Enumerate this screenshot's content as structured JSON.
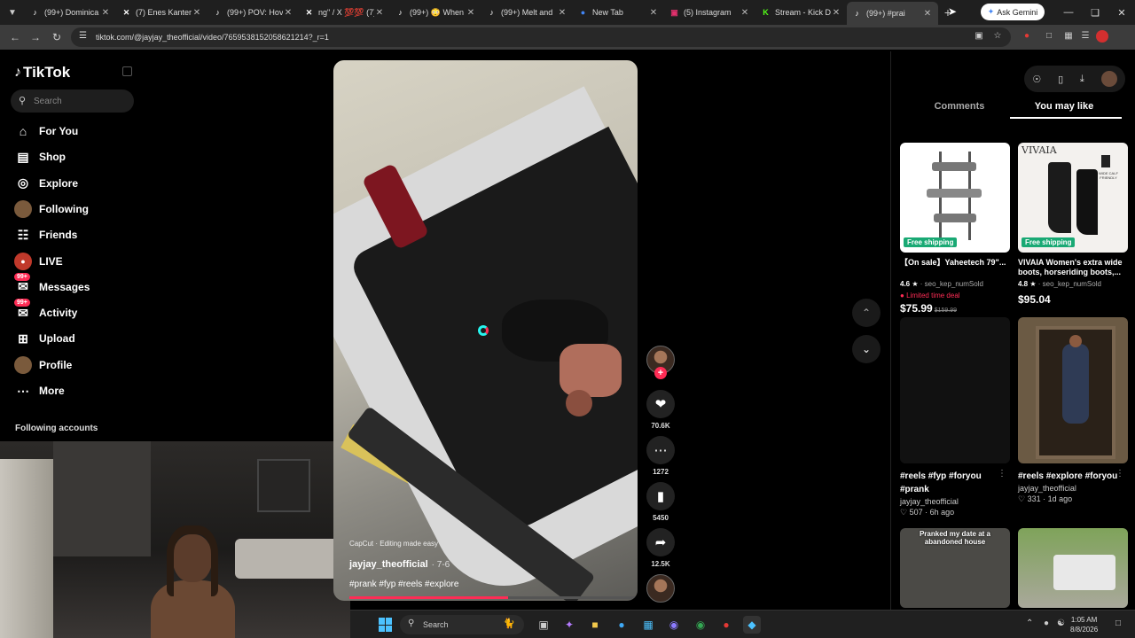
{
  "browser": {
    "tabs": [
      {
        "title": "(99+) Dominica",
        "icon": "tiktok"
      },
      {
        "title": "(7) Enes Kanter",
        "icon": "x"
      },
      {
        "title": "(99+) POV: Hov",
        "icon": "tiktok"
      },
      {
        "title": "ng\" / X 💯💯 (7)",
        "icon": "x"
      },
      {
        "title": "(99+) 😳 When",
        "icon": "tiktok"
      },
      {
        "title": "(99+) Melt and",
        "icon": "tiktok"
      },
      {
        "title": "New Tab",
        "icon": "chrome"
      },
      {
        "title": "(5) Instagram",
        "icon": "instagram"
      },
      {
        "title": "Stream - Kick D",
        "icon": "kick"
      },
      {
        "title": "(99+) #prai",
        "icon": "tiktok",
        "active": true
      }
    ],
    "ask_gemini": "Ask Gemini",
    "url": "tiktok.com/@jayjay_theofficial/video/7659538152058621214?_r=1"
  },
  "tiktok": {
    "logo": "TikTok",
    "search_placeholder": "Search",
    "nav": [
      {
        "label": "For You",
        "icon": "home-icon"
      },
      {
        "label": "Shop",
        "icon": "shop-icon"
      },
      {
        "label": "Explore",
        "icon": "compass-icon"
      },
      {
        "label": "Following",
        "icon": "following-avatar"
      },
      {
        "label": "Friends",
        "icon": "friends-icon"
      },
      {
        "label": "LIVE",
        "icon": "live-icon"
      },
      {
        "label": "Messages",
        "icon": "messages-icon",
        "badge": "99+"
      },
      {
        "label": "Activity",
        "icon": "activity-icon",
        "badge": "99+"
      },
      {
        "label": "Upload",
        "icon": "upload-icon"
      },
      {
        "label": "Profile",
        "icon": "profile-avatar"
      },
      {
        "label": "More",
        "icon": "more-icon"
      }
    ],
    "following_accounts": "Following accounts"
  },
  "video": {
    "watermark": "CapCut · Editing made easy",
    "author": "jayjay_theofficial",
    "date": "· 7-6",
    "tags": "#prank #fyp #reels #explore",
    "progress": 0.55,
    "likes": "70.6K",
    "comments": "1272",
    "saves": "5450",
    "shares": "12.5K"
  },
  "right_panel": {
    "tabs": [
      "Comments",
      "You may like"
    ],
    "products": [
      {
        "title": "【On sale】Yaheetech 79\"...",
        "rating": "4.6",
        "sold": "seo_kep_numSold",
        "limited": "Limited time deal",
        "price": "$75.99",
        "old_price": "$159.99",
        "free_shipping": "Free shipping"
      },
      {
        "title": "VIVAIA Women's extra wide boots, horseriding boots,...",
        "rating": "4.8",
        "sold": "seo_kep_numSold",
        "price": "$95.04",
        "free_shipping": "Free shipping",
        "brand": "VIVAIA",
        "badge_text": "WIDE CALF FRIENDLY"
      }
    ],
    "videos": [
      {
        "title": "#reels #fyp #foryou #prank",
        "author": "jayjay_theofficial",
        "likes": "507",
        "age": "6h ago"
      },
      {
        "title": "#reels #explore #foryou",
        "author": "jayjay_theofficial",
        "likes": "331",
        "age": "1d ago"
      },
      {
        "overlay": "Pranked my date at a abandoned house"
      }
    ]
  },
  "taskbar": {
    "search": "Search",
    "time": "1:05 AM",
    "date": "8/8/2026"
  }
}
